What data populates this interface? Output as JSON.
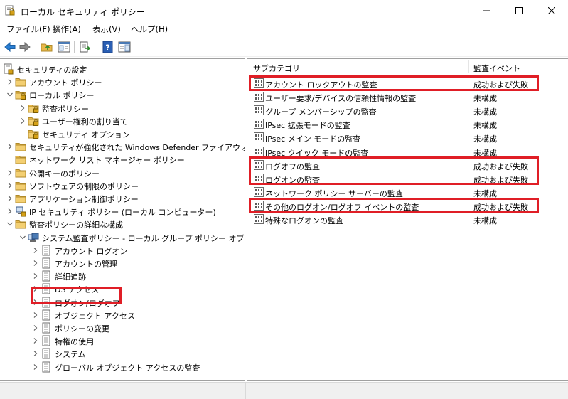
{
  "window": {
    "title": "ローカル セキュリティ ポリシー"
  },
  "menu": [
    {
      "label": "ファイル(F)"
    },
    {
      "label": "操作(A)"
    },
    {
      "label": "表示(V)"
    },
    {
      "label": "ヘルプ(H)"
    }
  ],
  "tree": [
    {
      "label": "セキュリティの設定",
      "depth": 0,
      "expander": "none",
      "icon": "security-settings-icon"
    },
    {
      "label": "アカウント ポリシー",
      "depth": 1,
      "expander": "collapsed",
      "icon": "folder-icon"
    },
    {
      "label": "ローカル ポリシー",
      "depth": 1,
      "expander": "expanded",
      "icon": "folder-lock-icon"
    },
    {
      "label": "監査ポリシー",
      "depth": 2,
      "expander": "collapsed",
      "icon": "folder-lock-icon"
    },
    {
      "label": "ユーザー権利の割り当て",
      "depth": 2,
      "expander": "collapsed",
      "icon": "folder-lock-icon"
    },
    {
      "label": "セキュリティ オプション",
      "depth": 2,
      "expander": "none",
      "icon": "folder-lock-icon"
    },
    {
      "label": "セキュリティが強化された Windows Defender ファイアウォール",
      "depth": 1,
      "expander": "collapsed",
      "icon": "folder-icon"
    },
    {
      "label": "ネットワーク リスト マネージャー ポリシー",
      "depth": 1,
      "expander": "none",
      "icon": "folder-icon"
    },
    {
      "label": "公開キーのポリシー",
      "depth": 1,
      "expander": "collapsed",
      "icon": "folder-icon"
    },
    {
      "label": "ソフトウェアの制限のポリシー",
      "depth": 1,
      "expander": "collapsed",
      "icon": "folder-icon"
    },
    {
      "label": "アプリケーション制御ポリシー",
      "depth": 1,
      "expander": "collapsed",
      "icon": "folder-icon"
    },
    {
      "label": "IP セキュリティ ポリシー (ローカル コンピューター)",
      "depth": 1,
      "expander": "collapsed",
      "icon": "ip-security-icon"
    },
    {
      "label": "監査ポリシーの詳細な構成",
      "depth": 1,
      "expander": "expanded",
      "icon": "folder-icon"
    },
    {
      "label": "システム監査ポリシー - ローカル グループ ポリシー オブジェクト",
      "depth": 2,
      "expander": "expanded",
      "icon": "group-policy-icon"
    },
    {
      "label": "アカウント ログオン",
      "depth": 3,
      "expander": "collapsed",
      "icon": "audit-category-icon"
    },
    {
      "label": "アカウントの管理",
      "depth": 3,
      "expander": "collapsed",
      "icon": "audit-category-icon"
    },
    {
      "label": "詳細追跡",
      "depth": 3,
      "expander": "collapsed",
      "icon": "audit-category-icon"
    },
    {
      "label": "DS アクセス",
      "depth": 3,
      "expander": "collapsed",
      "icon": "audit-category-icon"
    },
    {
      "label": "ログオン/ログオフ",
      "depth": 3,
      "expander": "collapsed",
      "icon": "audit-category-icon"
    },
    {
      "label": "オブジェクト アクセス",
      "depth": 3,
      "expander": "collapsed",
      "icon": "audit-category-icon"
    },
    {
      "label": "ポリシーの変更",
      "depth": 3,
      "expander": "collapsed",
      "icon": "audit-category-icon"
    },
    {
      "label": "特権の使用",
      "depth": 3,
      "expander": "collapsed",
      "icon": "audit-category-icon"
    },
    {
      "label": "システム",
      "depth": 3,
      "expander": "collapsed",
      "icon": "audit-category-icon"
    },
    {
      "label": "グローバル オブジェクト アクセスの監査",
      "depth": 3,
      "expander": "collapsed",
      "icon": "audit-category-icon"
    }
  ],
  "list": {
    "columns": [
      {
        "label": "サブカテゴリ"
      },
      {
        "label": "監査イベント"
      }
    ],
    "rows": [
      {
        "name": "アカウント ロックアウトの監査",
        "value": "成功および失敗"
      },
      {
        "name": "ユーザー要求/デバイスの信頼性情報の監査",
        "value": "未構成"
      },
      {
        "name": "グループ メンバーシップの監査",
        "value": "未構成"
      },
      {
        "name": "IPsec 拡張モードの監査",
        "value": "未構成"
      },
      {
        "name": "IPsec メイン モードの監査",
        "value": "未構成"
      },
      {
        "name": "IPsec クイック モードの監査",
        "value": "未構成"
      },
      {
        "name": "ログオフの監査",
        "value": "成功および失敗"
      },
      {
        "name": "ログオンの監査",
        "value": "成功および失敗"
      },
      {
        "name": "ネットワーク ポリシー サーバーの監査",
        "value": "未構成"
      },
      {
        "name": "その他のログオン/ログオフ イベントの監査",
        "value": "成功および失敗"
      },
      {
        "name": "特殊なログオンの監査",
        "value": "未構成"
      }
    ]
  },
  "colors": {
    "highlight": "#e01e26",
    "folder": "#e8b84a",
    "lock": "#d4a017"
  }
}
